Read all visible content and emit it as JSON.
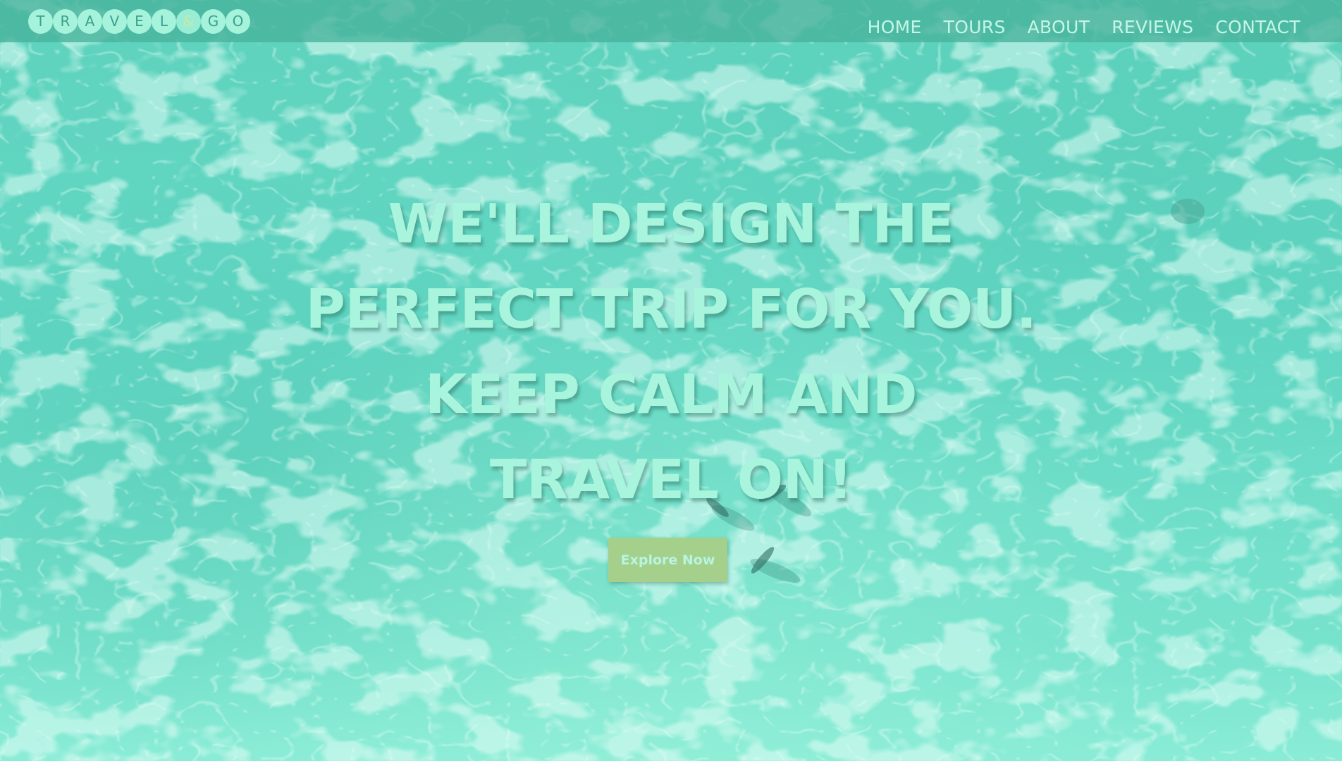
{
  "colors": {
    "navbar_background": "#48b29b",
    "water": "#63d8c4",
    "logo_circle": "#a6f3dc",
    "headline_text": "#a8f4dc",
    "button_background": "#a4d08c",
    "button_text": "#b7f5e0"
  },
  "header": {
    "logo_letters": [
      "T",
      "R",
      "A",
      "V",
      "E",
      "L",
      "&",
      "G",
      "O"
    ],
    "nav": [
      "HOME",
      "TOURS",
      "ABOUT",
      "REVIEWS",
      "CONTACT"
    ]
  },
  "hero": {
    "background": "aerial-water-image",
    "headline_lines": [
      "WE'LL DESIGN THE",
      "PERFECT TRIP FOR YOU.",
      "KEEP CALM AND",
      "TRAVEL ON!"
    ],
    "cta_label": "Explore Now"
  }
}
